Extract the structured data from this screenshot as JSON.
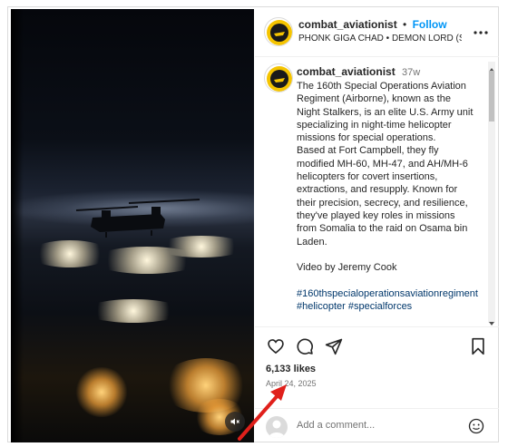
{
  "post": {
    "username": "combat_aviationist",
    "follow_label": "Follow",
    "dot": "•",
    "audio": "PHONK GIGA CHAD • DEMON LORD (SI...",
    "caption_time": "37w",
    "caption_text": "The 160th Special Operations Aviation Regiment (Airborne), known as the Night Stalkers, is an elite U.S. Army unit specializing in night-time helicopter missions for special operations.\nBased at Fort Campbell, they fly modified MH-60, MH-47, and AH/MH-6 helicopters for covert insertions, extractions, and resupply. Known for their precision, secrecy, and resilience, they've played key roles in missions from Somalia to the raid on Osama bin Laden.\n\nVideo by Jeremy Cook\n\n",
    "hashtags": "#160thspecialoperationsaviationregiment #helicopter #specialforces",
    "likes": "6,133 likes",
    "date": "April 24, 2025",
    "comment_placeholder": "Add a comment..."
  },
  "icons": {
    "like": "heart-icon",
    "comment": "comment-icon",
    "share": "share-icon",
    "save": "bookmark-icon",
    "more": "more-options-icon",
    "emoji": "emoji-icon",
    "mute": "muted-audio-icon"
  },
  "colors": {
    "follow": "#0095f6",
    "hashtag": "#00376b",
    "annotation_arrow": "#e0201b"
  }
}
